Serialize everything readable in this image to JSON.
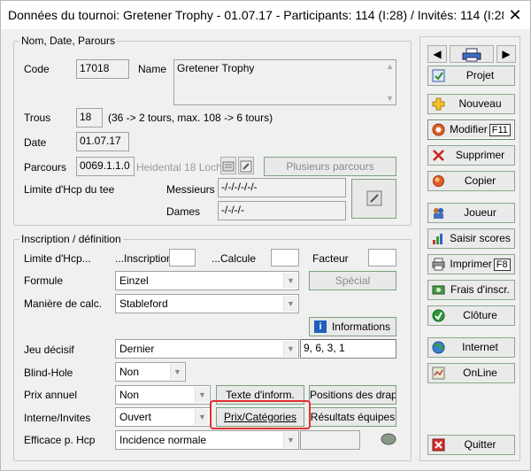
{
  "window": {
    "title": "Données du tournoi: Gretener Trophy - 01.07.17 - Participants: 114 (I:28) / Invités: 114 (I:28) ...",
    "close_glyph": "✕"
  },
  "nom": {
    "legend": "Nom, Date, Parours",
    "code_label": "Code",
    "code_value": "17018",
    "name_label": "Name",
    "name_value": "Gretener Trophy",
    "trous_label": "Trous",
    "trous_value": "18",
    "trous_hint": "(36 -> 2 tours, max. 108 -> 6 tours)",
    "date_label": "Date",
    "date_value": "01.07.17",
    "parcours_label": "Parcours",
    "parcours_value": "0069.1.1.0",
    "parcours_name": "Heidental 18 Loch",
    "plusieurs_btn": "Plusieurs parcours",
    "hcp_label": "Limite d'Hcp du tee",
    "messieurs_label": "Messieurs",
    "messieurs_value": "-/-/-/-/-/-",
    "dames_label": "Dames",
    "dames_value": "-/-/-/-"
  },
  "inscr": {
    "legend": "Inscription / définition",
    "hcp_label": "Limite d'Hcp...",
    "inscription_label": "...Inscription",
    "calcule_label": "...Calcule",
    "facteur_label": "Facteur",
    "formule_label": "Formule",
    "formule_value": "Einzel",
    "special_btn": "Spécial",
    "maniere_label": "Manière de calc.",
    "maniere_value": "Stableford",
    "informations_btn": "Informations",
    "jeu_label": "Jeu décisif",
    "jeu_value": "Dernier",
    "jeu_holes": "9, 6, 3, 1",
    "blind_label": "Blind-Hole",
    "blind_value": "Non",
    "prix_label": "Prix annuel",
    "prix_value": "Non",
    "texte_btn": "Texte d'inform.",
    "positions_btn": "Positions des drap",
    "interne_label": "Interne/Invites",
    "interne_value": "Ouvert",
    "prixcat_btn": "Prix/Catégories",
    "resultats_btn": "Résultats équipes",
    "efficace_label": "Efficace p. Hcp",
    "efficace_value": "Incidence normale"
  },
  "sidebar": {
    "projet": "Projet",
    "nouveau": "Nouveau",
    "modifier": "Modifier",
    "modifier_key": "F11",
    "supprimer": "Supprimer",
    "copier": "Copier",
    "joueur": "Joueur",
    "saisir": "Saisir scores",
    "imprimer": "Imprimer",
    "imprimer_key": "F8",
    "frais": "Frais d'inscr.",
    "cloture": "Clôture",
    "internet": "Internet",
    "online": "OnLine",
    "quitter": "Quitter"
  }
}
